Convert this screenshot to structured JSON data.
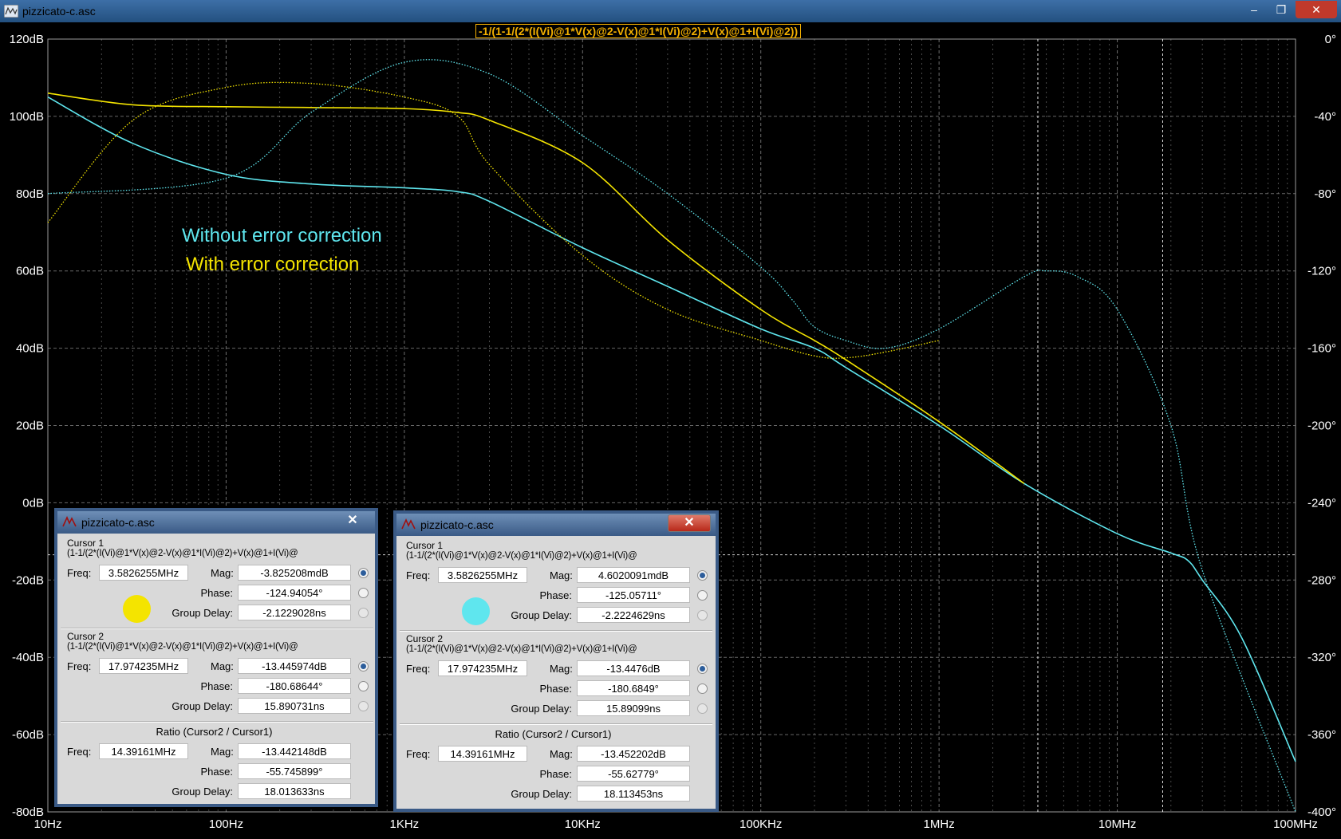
{
  "window": {
    "title": "pizzicato-c.asc",
    "minimize": "–",
    "maximize": "❐",
    "close": "✕"
  },
  "plot": {
    "expression": "-1/(1-1/(2*(I(Vi)@1*V(x)@2-V(x)@1*I(Vi)@2)+V(x)@1+I(Vi)@2))",
    "left_ticks": [
      "120dB",
      "100dB",
      "80dB",
      "60dB",
      "40dB",
      "20dB",
      "0dB",
      "-20dB",
      "-40dB",
      "-60dB",
      "-80dB"
    ],
    "right_ticks": [
      "0°",
      "-40°",
      "-80°",
      "-120°",
      "-160°",
      "-200°",
      "-240°",
      "-280°",
      "-320°",
      "-360°",
      "-400°"
    ],
    "x_ticks": [
      "10Hz",
      "100Hz",
      "1KHz",
      "10KHz",
      "100KHz",
      "1MHz",
      "10MHz",
      "100MHz"
    ],
    "legend_without": "Without error correction",
    "legend_with": "With error correction",
    "colors": {
      "cyan": "#5fe6ee",
      "yellow": "#f4e400",
      "grid": "#7a7a7a",
      "cursor": "#ffffff"
    }
  },
  "chart_data": {
    "type": "line",
    "xscale": "log",
    "xlim": [
      10,
      100000000
    ],
    "ylim_mag": [
      -80,
      120
    ],
    "ylim_phase": [
      -400,
      0
    ],
    "cursors": [
      3582625.5,
      17974235
    ],
    "series": [
      {
        "name": "Without error correction",
        "color": "cyan",
        "kind": "magnitude",
        "x": [
          10,
          30,
          100,
          300,
          1000,
          2000,
          3000,
          10000,
          30000,
          100000,
          200000,
          300000,
          1000000,
          3000000,
          10000000,
          20000000,
          25000000,
          30000000,
          50000000,
          100000000
        ],
        "y": [
          105,
          93,
          85,
          82.5,
          81.5,
          80.5,
          78,
          66,
          56,
          45,
          40,
          35,
          20,
          5,
          -8,
          -13,
          -15,
          -20,
          -35,
          -67
        ]
      },
      {
        "name": "With error correction",
        "color": "yellow",
        "kind": "magnitude",
        "x": [
          10,
          30,
          100,
          300,
          1000,
          2000,
          3000,
          10000,
          30000,
          100000,
          200000,
          300000,
          1000000,
          3000000
        ],
        "y": [
          106,
          103,
          102.5,
          102.3,
          102,
          101,
          99,
          88,
          68,
          50,
          42,
          37,
          21,
          5
        ]
      },
      {
        "name": "Without error correction",
        "color": "cyan",
        "kind": "phase",
        "x": [
          10,
          100,
          300,
          1000,
          3000,
          10000,
          30000,
          100000,
          150000,
          200000,
          300000,
          500000,
          1000000,
          3000000,
          4000000,
          6000000,
          10000000,
          20000000,
          30000000,
          100000000
        ],
        "y": [
          -80,
          -72,
          -38,
          -12,
          -18,
          -50,
          -80,
          -118,
          -135,
          -149,
          -156,
          -160,
          -150,
          -123,
          -120,
          -123,
          -140,
          -200,
          -275,
          -400
        ]
      },
      {
        "name": "With error correction",
        "color": "yellow",
        "kind": "phase",
        "x": [
          10,
          30,
          100,
          300,
          1000,
          2000,
          3000,
          10000,
          30000,
          100000,
          200000,
          300000,
          500000,
          1000000
        ],
        "y": [
          -95,
          -42,
          -25,
          -23,
          -30,
          -40,
          -65,
          -112,
          -140,
          -156,
          -164,
          -165,
          -162,
          -156
        ]
      }
    ]
  },
  "dialog1": {
    "title": "pizzicato-c.asc",
    "close": "✕",
    "cursor1": {
      "head": "Cursor 1",
      "expr": "(1-1/(2*(I(Vi)@1*V(x)@2-V(x)@1*I(Vi)@2)+V(x)@1+I(Vi)@",
      "freq_label": "Freq:",
      "freq": "3.5826255MHz",
      "mag_label": "Mag:",
      "mag": "-3.825208mdB",
      "phase_label": "Phase:",
      "phase": "-124.94054°",
      "gd_label": "Group Delay:",
      "gd": "-2.1229028ns"
    },
    "cursor2": {
      "head": "Cursor 2",
      "expr": "(1-1/(2*(I(Vi)@1*V(x)@2-V(x)@1*I(Vi)@2)+V(x)@1+I(Vi)@",
      "freq_label": "Freq:",
      "freq": "17.974235MHz",
      "mag_label": "Mag:",
      "mag": "-13.445974dB",
      "phase_label": "Phase:",
      "phase": "-180.68644°",
      "gd_label": "Group Delay:",
      "gd": "15.890731ns"
    },
    "ratio": {
      "head": "Ratio (Cursor2 / Cursor1)",
      "freq_label": "Freq:",
      "freq": "14.39161MHz",
      "mag_label": "Mag:",
      "mag": "-13.442148dB",
      "phase_label": "Phase:",
      "phase": "-55.745899°",
      "gd_label": "Group Delay:",
      "gd": "18.013633ns"
    },
    "dot_color": "#f4e400"
  },
  "dialog2": {
    "title": "pizzicato-c.asc",
    "close": "✕",
    "cursor1": {
      "head": "Cursor 1",
      "expr": "(1-1/(2*(I(Vi)@1*V(x)@2-V(x)@1*I(Vi)@2)+V(x)@1+I(Vi)@",
      "freq_label": "Freq:",
      "freq": "3.5826255MHz",
      "mag_label": "Mag:",
      "mag": "4.6020091mdB",
      "phase_label": "Phase:",
      "phase": "-125.05711°",
      "gd_label": "Group Delay:",
      "gd": "-2.2224629ns"
    },
    "cursor2": {
      "head": "Cursor 2",
      "expr": "(1-1/(2*(I(Vi)@1*V(x)@2-V(x)@1*I(Vi)@2)+V(x)@1+I(Vi)@",
      "freq_label": "Freq:",
      "freq": "17.974235MHz",
      "mag_label": "Mag:",
      "mag": "-13.4476dB",
      "phase_label": "Phase:",
      "phase": "-180.6849°",
      "gd_label": "Group Delay:",
      "gd": "15.89099ns"
    },
    "ratio": {
      "head": "Ratio (Cursor2 / Cursor1)",
      "freq_label": "Freq:",
      "freq": "14.39161MHz",
      "mag_label": "Mag:",
      "mag": "-13.452202dB",
      "phase_label": "Phase:",
      "phase": "-55.62779°",
      "gd_label": "Group Delay:",
      "gd": "18.113453ns"
    },
    "dot_color": "#5fe6ee"
  }
}
